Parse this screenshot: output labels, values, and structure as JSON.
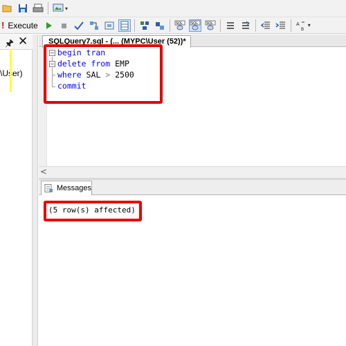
{
  "toolbar": {
    "execute_label": "Execute",
    "execute_prefix": "!"
  },
  "object_explorer": {
    "pin_icon": "pushpin-icon",
    "close_icon": "close-icon",
    "tree_item_partial": "\\User)"
  },
  "editor": {
    "tab_title": "SQLQuery7.sql - (... (MYPC\\User (52))*",
    "code": {
      "line1": "begin tran",
      "line2_kw": "delete from",
      "line2_rest": " EMP",
      "line3_kw": "where",
      "line3_col": " SAL ",
      "line3_op": ">",
      "line3_val": " 2500",
      "line4": "commit"
    },
    "annotation_color": "#e30000"
  },
  "results": {
    "tab_label": "Messages",
    "message": "(5 row(s) affected)"
  }
}
